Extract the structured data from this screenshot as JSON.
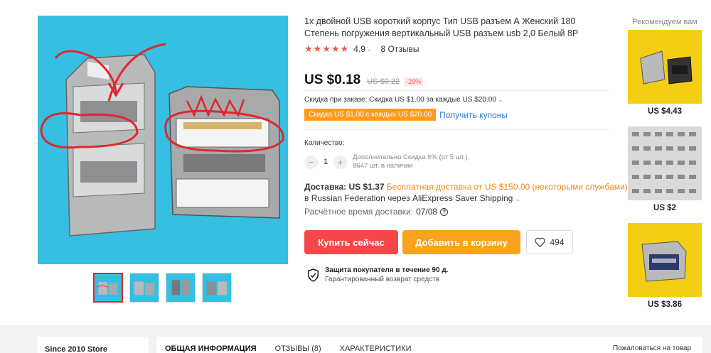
{
  "product": {
    "title": "1x двойной USB короткий корпус Тип USB разъем А Женский 180 Степень погружения вертикальный USB разъем usb 2,0 Белый 8P",
    "stars": "★★★★★",
    "rating": "4.9",
    "reviews_label": "8 Отзывы",
    "price": "US $0.18",
    "old_price": "US $0.22",
    "discount": "-20%",
    "order_discount": "Скидка при заказе: Скидка US $1.00 за каждые US $20.00",
    "coupon_chip": "Скидка US $1.00 с каждых US $20.00",
    "coupon_link": "Получить купоны",
    "quantity_label": "Количество:",
    "quantity_value": "1",
    "qty_discount": "Дополнительно Скидка 6% (от 5 шт.)",
    "stock": "8647 шт. в наличии",
    "delivery_label": "Доставка:",
    "delivery_price": "US $1.37",
    "delivery_free": "Бесплатная доставка от US $150.00 (некоторыми службами)",
    "delivery_via": "в Russian Federation через AliExpress Saver Shipping",
    "delivery_time_label": "Расчётное время доставки:",
    "delivery_time": "07/08",
    "buy_label": "Купить сейчас",
    "cart_label": "Добавить в корзину",
    "wish_count": "494",
    "protect_title": "Защита покупателя в течение 90 д.",
    "protect_sub": "Гарантированный возврат средств"
  },
  "recommended": {
    "title": "Рекомендуем вам",
    "items": [
      {
        "price": "US $4.43"
      },
      {
        "price": "US $2"
      },
      {
        "price": "US $3.86"
      }
    ]
  },
  "bottom": {
    "store_name": "Since 2010 Store",
    "tabs": [
      "ОБЩАЯ ИНФОРМАЦИЯ",
      "ОТЗЫВЫ (8)",
      "ХАРАКТЕРИСТИКИ"
    ],
    "complaint": "Пожаловаться на товар"
  },
  "colors": {
    "accent_red": "#f5474a",
    "accent_orange": "#f9a21b",
    "link_blue": "#2a7ed3",
    "image_bg": "#35bfe3"
  }
}
